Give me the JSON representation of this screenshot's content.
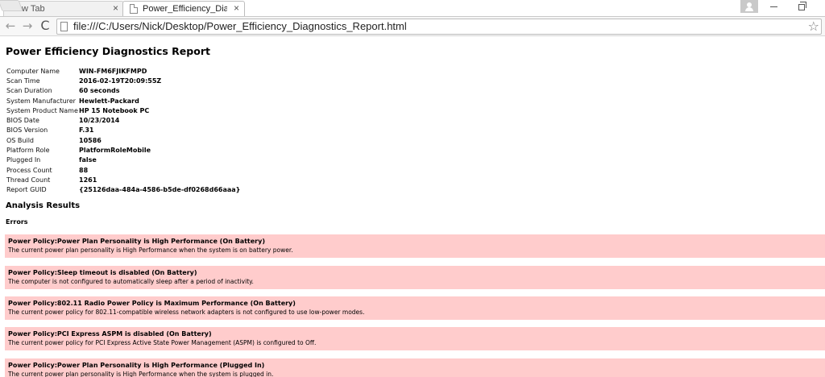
{
  "browser": {
    "tabs": [
      {
        "label": "New Tab",
        "close": "×"
      },
      {
        "label": "Power_Efficiency_Diagnost",
        "close": "×"
      }
    ],
    "url": "file:///C:/Users/Nick/Desktop/Power_Efficiency_Diagnostics_Report.html",
    "nav": {
      "back": "←",
      "forward": "→",
      "reload": "C",
      "star": "☆"
    }
  },
  "report": {
    "title": "Power Efficiency Diagnostics Report",
    "info": [
      {
        "key": "Computer Name",
        "value": "WIN-FM6FJIKFMPD"
      },
      {
        "key": "Scan Time",
        "value": "2016-02-19T20:09:55Z"
      },
      {
        "key": "Scan Duration",
        "value": "60 seconds"
      },
      {
        "key": "System Manufacturer",
        "value": "Hewlett-Packard"
      },
      {
        "key": "System Product Name",
        "value": "HP 15 Notebook PC"
      },
      {
        "key": "BIOS Date",
        "value": "10/23/2014"
      },
      {
        "key": "BIOS Version",
        "value": "F.31"
      },
      {
        "key": "OS Build",
        "value": "10586"
      },
      {
        "key": "Platform Role",
        "value": "PlatformRoleMobile"
      },
      {
        "key": "Plugged In",
        "value": "false"
      },
      {
        "key": "Process Count",
        "value": "88"
      },
      {
        "key": "Thread Count",
        "value": "1261"
      },
      {
        "key": "Report GUID",
        "value": "{25126daa-484a-4586-b5de-df0268d66aaa}"
      }
    ],
    "analysis_title": "Analysis Results",
    "errors_title": "Errors",
    "errors": [
      {
        "title": "Power Policy:Power Plan Personality is High Performance (On Battery)",
        "desc": "The current power plan personality is High Performance when the system is on battery power."
      },
      {
        "title": "Power Policy:Sleep timeout is disabled (On Battery)",
        "desc": "The computer is not configured to automatically sleep after a period of inactivity."
      },
      {
        "title": "Power Policy:802.11 Radio Power Policy is Maximum Performance (On Battery)",
        "desc": "The current power policy for 802.11-compatible wireless network adapters is not configured to use low-power modes."
      },
      {
        "title": "Power Policy:PCI Express ASPM is disabled (On Battery)",
        "desc": "The current power policy for PCI Express Active State Power Management (ASPM) is configured to Off."
      },
      {
        "title": "Power Policy:Power Plan Personality is High Performance (Plugged In)",
        "desc": "The current power plan personality is High Performance when the system is plugged in."
      }
    ]
  },
  "colors": {
    "error_bg": "#ffcccc",
    "chrome_bg": "#f7f7f7"
  }
}
